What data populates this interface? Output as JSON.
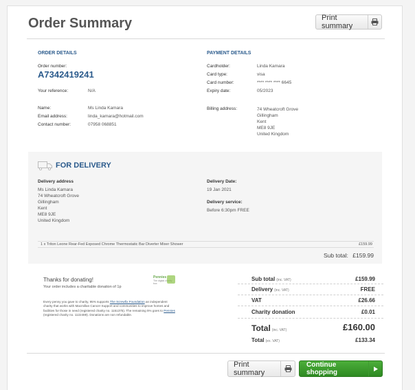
{
  "page_title": "Order Summary",
  "print_label": "Print summary",
  "continue_label": "Continue shopping",
  "order": {
    "heading": "ORDER DETAILS",
    "number_label": "Order number:",
    "number": "A7342419241",
    "ref_label": "Your reference:",
    "ref": "N/A",
    "name_label": "Name:",
    "name": "Ms Linda Kamara",
    "email_label": "Email address:",
    "email": "linda_kamara@hotmail.com",
    "contact_label": "Contact number:",
    "contact": "07958 068851"
  },
  "payment": {
    "heading": "PAYMENT DETAILS",
    "cardholder_label": "Cardholder:",
    "cardholder": "Linda Kamara",
    "card_type_label": "Card type:",
    "card_type": "visa",
    "card_number_label": "Card number:",
    "card_number": "**** **** **** 6645",
    "expiry_label": "Expiry date:",
    "expiry": "05/2023",
    "billing_label": "Billing address:",
    "billing": [
      "74 Wheatcroft Grove",
      "Gillingham",
      "Kent",
      "ME8 9JE",
      "United Kingdom"
    ]
  },
  "delivery": {
    "heading": "FOR DELIVERY",
    "address_label": "Delivery address",
    "address": [
      "Ms Linda Kamara",
      "74 Wheatcroft Grove",
      "Gillingham",
      "Kent",
      "ME8 9JE",
      "United Kingdom"
    ],
    "date_label": "Delivery Date:",
    "date": "19 Jan 2021",
    "service_label": "Delivery service:",
    "service": "Before 6:30pm FREE",
    "item": "1 x Triton Leone Rear-Fed Exposed Chrome Thermostatic Bar Diverter Mixer Shower",
    "item_price": "£159.99",
    "subtotal_label": "Sub total:",
    "subtotal": "£159.99"
  },
  "donation": {
    "title": "Thanks for donating!",
    "amount_text": "Your order includes a charitable donation of 1p",
    "body_1": "Every penny you gave to charity, 95% supports ",
    "link_1": "The Screwfix Foundation",
    "body_2": " an independent charity that works with Macmillan Cancer Support and communities to improve homes and facilities for those in need (registered charity no. 1151375). The remaining 5% goes to ",
    "link_2": "Pennies",
    "body_3": " (registered charity no. 1122489). Donations are non refundable.",
    "logo_main": "Pennies",
    "logo_sub": "The digital charity box"
  },
  "totals": {
    "vat_note": "(inc. VAT)",
    "sub_total_label": "Sub total",
    "sub_total": "£159.99",
    "delivery_label": "Delivery",
    "delivery": "FREE",
    "vat_label": "VAT",
    "vat": "£26.66",
    "charity_label": "Charity donation",
    "charity": "£0.01",
    "total_label": "Total",
    "total": "£160.00",
    "total_ex_label": "Total",
    "ex_note": "(ex. VAT)",
    "total_ex": "£133.34"
  }
}
